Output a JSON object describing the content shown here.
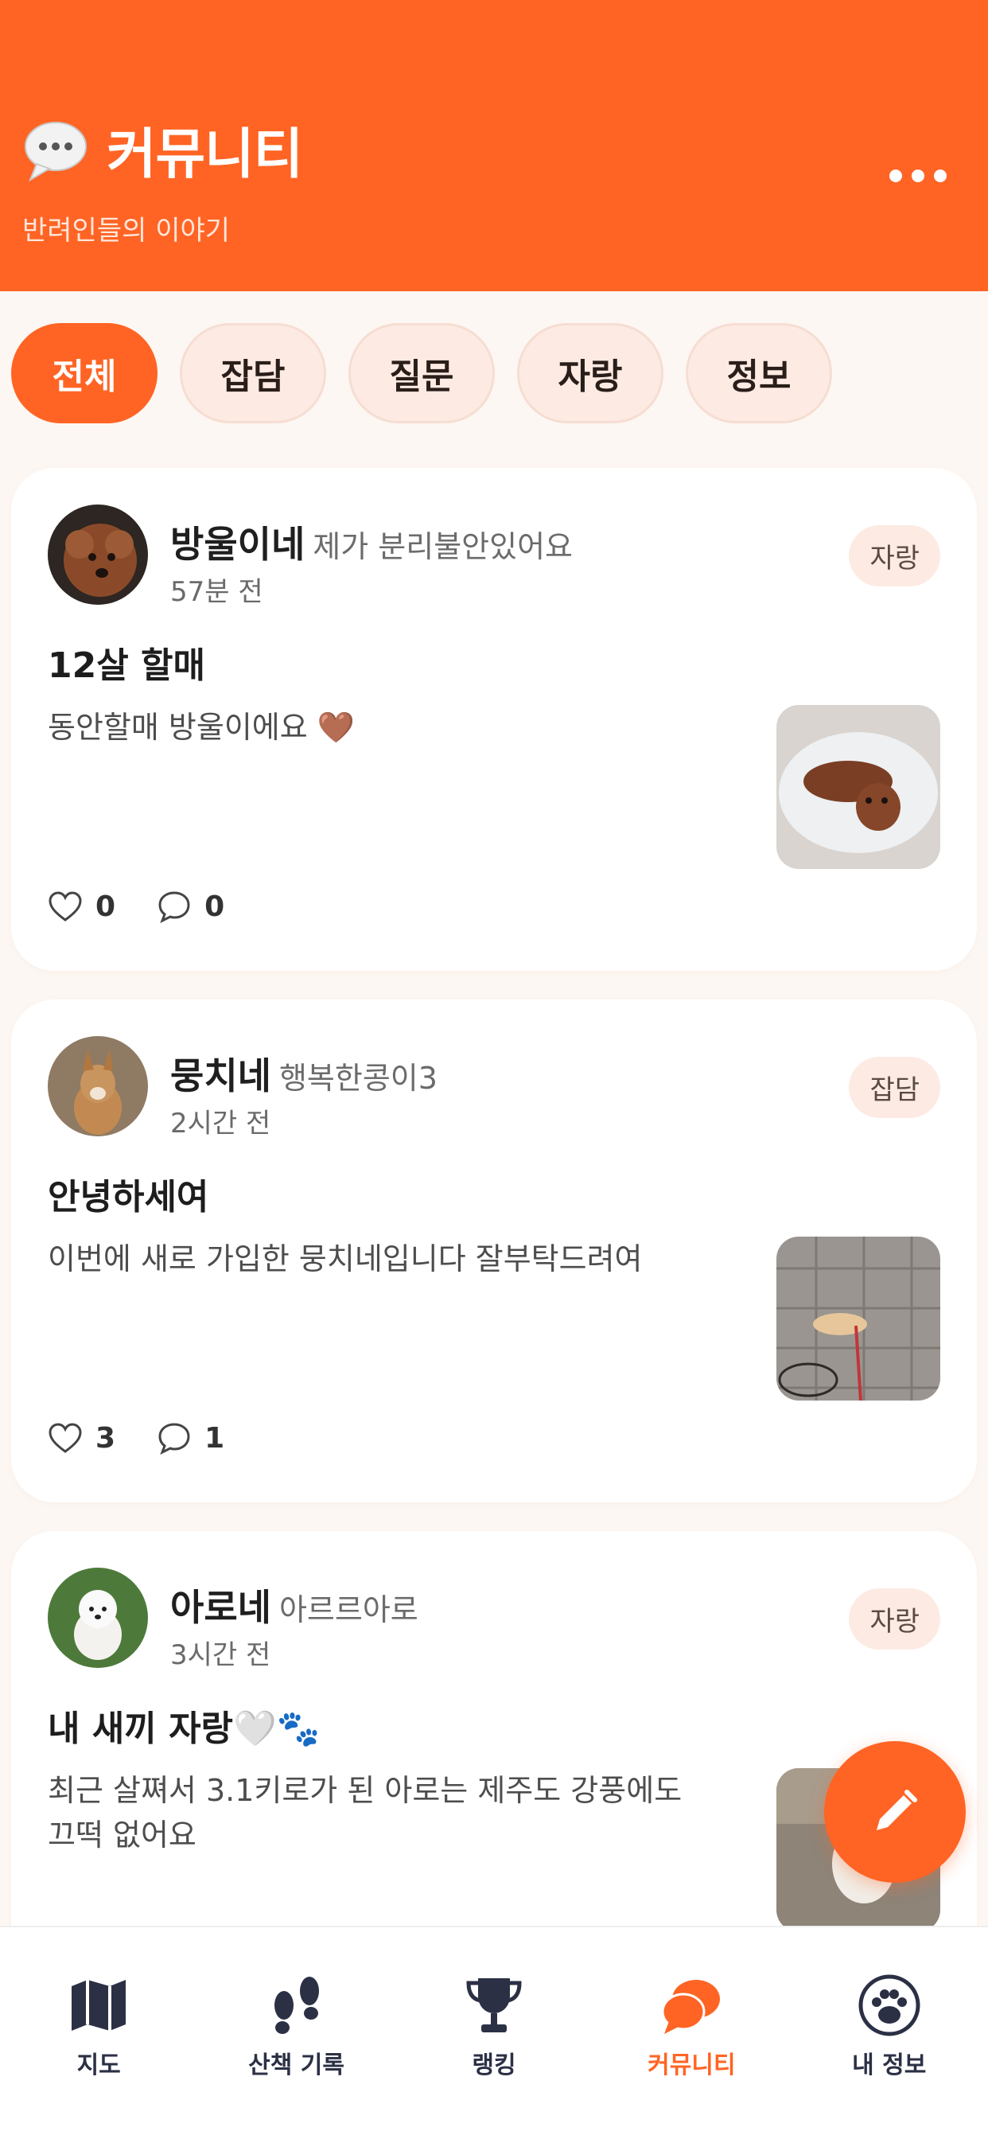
{
  "header": {
    "title": "커뮤니티",
    "subtitle": "반려인들의 이야기",
    "accent_color": "#ff6424"
  },
  "filters": [
    {
      "label": "전체",
      "active": true
    },
    {
      "label": "잡담",
      "active": false
    },
    {
      "label": "질문",
      "active": false
    },
    {
      "label": "자랑",
      "active": false
    },
    {
      "label": "정보",
      "active": false
    }
  ],
  "posts": [
    {
      "author": "방울이네",
      "pet": "제가 분리불안있어요",
      "time": "57분 전",
      "category": "자랑",
      "title": "12살 할매",
      "body": "동안할매 방울이에요 🤎",
      "likes": "0",
      "comments": "0"
    },
    {
      "author": "뭉치네",
      "pet": "행복한콩이3",
      "time": "2시간 전",
      "category": "잡담",
      "title": "안녕하세여",
      "body": "이번에 새로 가입한 뭉치네입니다 잘부탁드려여",
      "likes": "3",
      "comments": "1"
    },
    {
      "author": "아로네",
      "pet": "아르르아로",
      "time": "3시간 전",
      "category": "자랑",
      "title": "내 새끼 자랑🤍🐾",
      "body": "최근 살쪄서 3.1키로가 된 아로는 제주도 강풍에도 끄떡 없어요"
    }
  ],
  "nav": [
    {
      "label": "지도",
      "icon": "map-icon"
    },
    {
      "label": "산책 기록",
      "icon": "footprints-icon"
    },
    {
      "label": "랭킹",
      "icon": "trophy-icon"
    },
    {
      "label": "커뮤니티",
      "icon": "chat-icon",
      "active": true
    },
    {
      "label": "내 정보",
      "icon": "paw-icon"
    }
  ]
}
